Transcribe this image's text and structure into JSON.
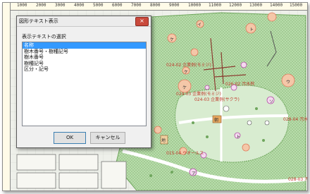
{
  "ruler": {
    "marks": [
      "1000",
      "2000",
      "3000",
      "4000",
      "5000",
      "6000",
      "7000",
      "8000",
      "9000",
      "10000",
      "11000",
      "12000",
      "13000",
      "14000",
      "15000"
    ]
  },
  "map": {
    "labels": [
      "024-02 企業例(モミジ)",
      "024-03 企業例(モミジ)",
      "026-02 汚水桝",
      "024-03 企業例(サクラ)",
      "015-04 ウオールス",
      "028-04 汚水",
      "028-03 汚"
    ],
    "tree_glyphs": [
      "イ",
      "ケ",
      "ケ",
      "ト",
      "ソ",
      "ウ",
      "ケ",
      "朝",
      "地",
      "ト",
      "ア"
    ]
  },
  "dialog": {
    "title": "図形テキスト表示",
    "close_label": "×",
    "group_label": "表示テキストの選択",
    "items": [
      "名称",
      "樹木番号・樹種記号",
      "樹木番号",
      "樹種記号",
      "区分・記号"
    ],
    "selected_index": 0,
    "ok_label": "OK",
    "cancel_label": "キャンセル"
  },
  "colors": {
    "vegetation": "#b8dcab",
    "road": "#ffffff",
    "tree_fill": "#f4c7a8",
    "tree_stroke": "#e07b5c",
    "accent_text": "#c0392b",
    "selection": "#3399ff"
  }
}
